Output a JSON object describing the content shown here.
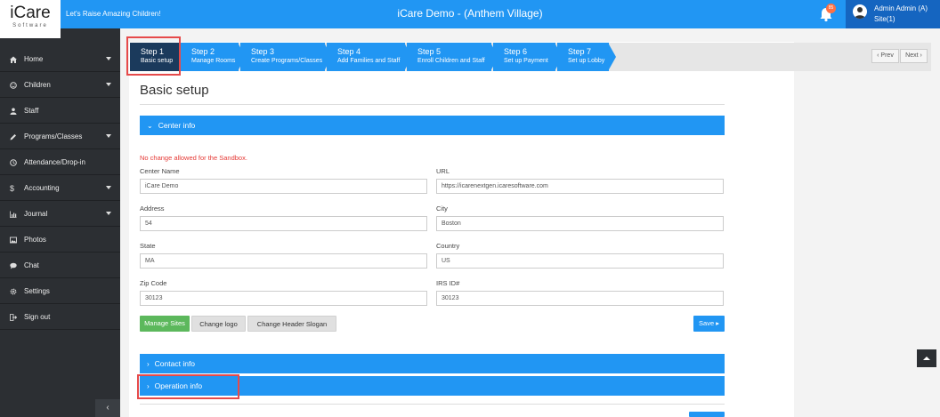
{
  "brand": {
    "logo_main": "iCare",
    "logo_sub": "Software",
    "slogan": "Let's Raise Amazing Children!"
  },
  "header": {
    "title": "iCare Demo - (Anthem Village)",
    "notification_count": "85",
    "user_name": "Admin Admin (A)",
    "user_site": "Site(1)"
  },
  "sidebar": {
    "items": [
      {
        "label": "Home",
        "icon": "home-icon",
        "has_caret": true
      },
      {
        "label": "Children",
        "icon": "children-icon",
        "has_caret": true
      },
      {
        "label": "Staff",
        "icon": "staff-icon",
        "has_caret": false
      },
      {
        "label": "Programs/Classes",
        "icon": "pencil-icon",
        "has_caret": true
      },
      {
        "label": "Attendance/Drop-in",
        "icon": "clock-icon",
        "has_caret": false
      },
      {
        "label": "Accounting",
        "icon": "dollar-icon",
        "has_caret": true
      },
      {
        "label": "Journal",
        "icon": "chart-icon",
        "has_caret": true
      },
      {
        "label": "Photos",
        "icon": "photo-icon",
        "has_caret": false
      },
      {
        "label": "Chat",
        "icon": "chat-icon",
        "has_caret": false
      },
      {
        "label": "Settings",
        "icon": "gear-icon",
        "has_caret": false
      },
      {
        "label": "Sign out",
        "icon": "signout-icon",
        "has_caret": false
      }
    ],
    "collapse_glyph": "‹"
  },
  "steps": [
    {
      "num": "Step 1",
      "label": "Basic setup",
      "active": true
    },
    {
      "num": "Step 2",
      "label": "Manage Rooms"
    },
    {
      "num": "Step 3",
      "label": "Create Programs/Classes"
    },
    {
      "num": "Step 4",
      "label": "Add Families and Staff"
    },
    {
      "num": "Step 5",
      "label": "Enroll Children and Staff"
    },
    {
      "num": "Step 6",
      "label": "Set up Payment"
    },
    {
      "num": "Step 7",
      "label": "Set up Lobby"
    }
  ],
  "pager": {
    "prev": "‹ Prev",
    "next": "Next ›"
  },
  "page": {
    "title": "Basic setup",
    "center_info": "Center info",
    "warning": "No change allowed for the Sandbox.",
    "fields": {
      "center_name": {
        "label": "Center Name",
        "value": "iCare Demo"
      },
      "url": {
        "label": "URL",
        "value": "https://icarenextgen.icaresoftware.com"
      },
      "address": {
        "label": "Address",
        "value": "54"
      },
      "city": {
        "label": "City",
        "value": "Boston"
      },
      "state": {
        "label": "State",
        "value": "MA"
      },
      "country": {
        "label": "Country",
        "value": "US"
      },
      "zip": {
        "label": "Zip Code",
        "value": "30123"
      },
      "irs": {
        "label": "IRS ID#",
        "value": "30123"
      }
    },
    "buttons": {
      "manage_sites": "Manage Sites",
      "change_logo": "Change logo",
      "change_slogan": "Change Header Slogan",
      "save": "Save ▸"
    },
    "contact_info": "Contact info",
    "operation_info": "Operation info"
  },
  "colors": {
    "primary": "#2196f3",
    "active_step": "#1b3a5c",
    "sidebar": "#2c2f33",
    "highlight": "#e64a4a",
    "warning": "#e53935",
    "green": "#5cb85c"
  }
}
